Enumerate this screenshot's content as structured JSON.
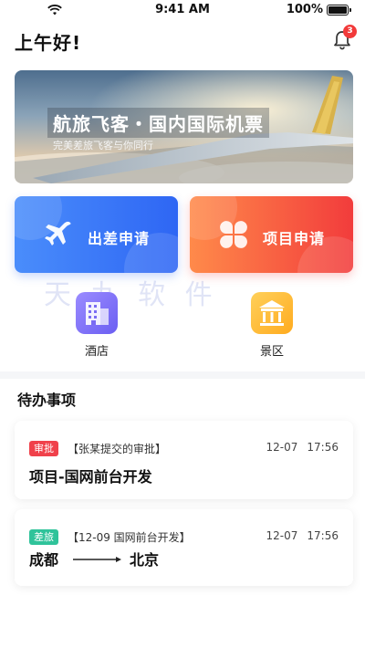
{
  "status": {
    "time": "9:41 AM",
    "battery": "100%"
  },
  "header": {
    "greeting": "上午好!",
    "notification_count": "3"
  },
  "banner": {
    "title": "航旅飞客・国内国际机票",
    "subtitle": "完美差旅飞客与你同行"
  },
  "actions": [
    {
      "label": "出差申请",
      "icon": "airplane-icon",
      "color": "#2e66f4"
    },
    {
      "label": "项目申请",
      "icon": "clover-icon",
      "color": "#f23c3c"
    }
  ],
  "watermark": "天 九 软 件",
  "quick": [
    {
      "label": "酒店",
      "icon": "hotel-icon"
    },
    {
      "label": "景区",
      "icon": "scenic-temple-icon"
    }
  ],
  "todo": {
    "title": "待办事项",
    "items": [
      {
        "tag": "审批",
        "subtitle": "【张某提交的审批】",
        "date": "12-07",
        "time": "17:56",
        "main": "项目-国网前台开发"
      },
      {
        "tag": "差旅",
        "subtitle": "【12-09 国网前台开发】",
        "date": "12-07",
        "time": "17:56",
        "from": "成都",
        "to": "北京"
      }
    ]
  }
}
